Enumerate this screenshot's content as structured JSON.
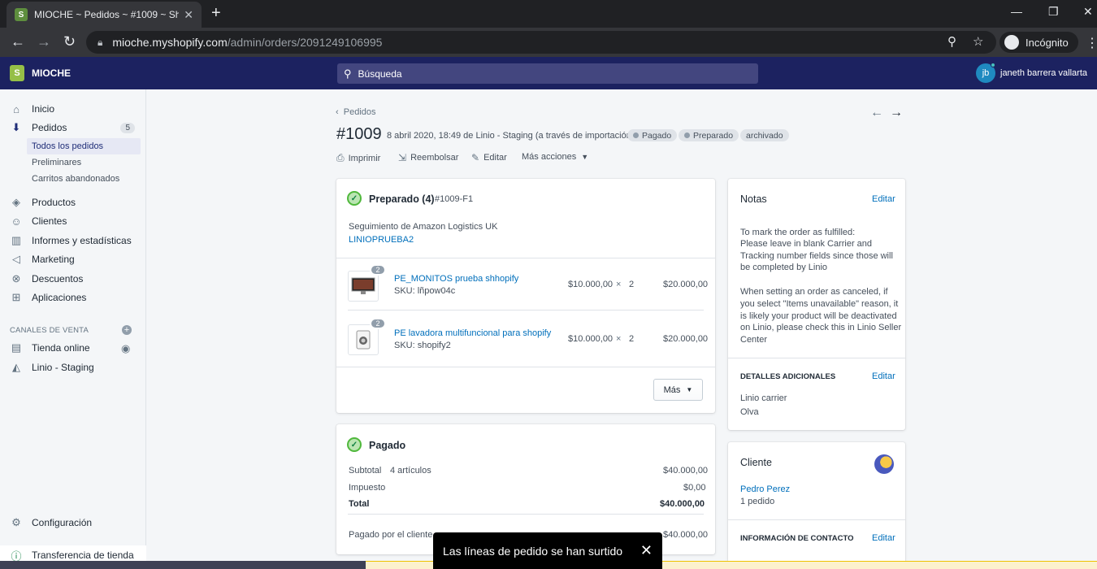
{
  "browser": {
    "tab_title": "MIOCHE ~ Pedidos ~ #1009 ~ Sh",
    "url_host": "mioche.myshopify.com",
    "url_path": "/admin/orders/2091249106995",
    "incognito_label": "Incógnito"
  },
  "topbar": {
    "shop_name": "MIOCHE",
    "search_placeholder": "Búsqueda",
    "avatar_initials": "jb",
    "user_name": "janeth barrera vallarta"
  },
  "sidebar": {
    "items": [
      {
        "label": "Inicio",
        "icon": "home-icon"
      },
      {
        "label": "Pedidos",
        "icon": "orders-icon",
        "badge": "5"
      },
      {
        "label": "Productos",
        "icon": "tag-icon"
      },
      {
        "label": "Clientes",
        "icon": "person-icon"
      },
      {
        "label": "Informes y estadísticas",
        "icon": "chart-icon"
      },
      {
        "label": "Marketing",
        "icon": "megaphone-icon"
      },
      {
        "label": "Descuentos",
        "icon": "discount-icon"
      },
      {
        "label": "Aplicaciones",
        "icon": "apps-icon"
      }
    ],
    "sub_items": [
      "Todos los pedidos",
      "Preliminares",
      "Carritos abandonados"
    ],
    "channels_label": "CANALES DE VENTA",
    "channels": [
      "Tienda online",
      "Linio - Staging"
    ],
    "settings_label": "Configuración",
    "transfer_label": "Transferencia de tienda"
  },
  "order": {
    "breadcrumb": "Pedidos",
    "number": "#1009",
    "meta": "8 abril 2020, 18:49 de Linio - Staging (a través de importación)",
    "badges": [
      "Pagado",
      "Preparado",
      "archivado"
    ],
    "actions": [
      "Imprimir",
      "Reembolsar",
      "Editar",
      "Más acciones"
    ]
  },
  "fulfillment": {
    "title": "Preparado (4)",
    "id": "#1009-F1",
    "tracking_label": "Seguimiento de Amazon Logistics UK",
    "tracking_number": "LINIOPRUEBA2",
    "items": [
      {
        "qty": "2",
        "name": "PE_MONITOS prueba shhopify",
        "sku": "SKU: lñpow04c",
        "price": "$10.000,00",
        "times": "×",
        "count": "2",
        "total": "$20.000,00"
      },
      {
        "qty": "2",
        "name": "PE lavadora multifuncional para shopify",
        "sku": "SKU: shopify2",
        "price": "$10.000,00",
        "times": "×",
        "count": "2",
        "total": "$20.000,00"
      }
    ],
    "more_button": "Más"
  },
  "payment": {
    "title": "Pagado",
    "subtotal_label": "Subtotal",
    "subtotal_items": "4 artículos",
    "subtotal": "$40.000,00",
    "tax_label": "Impuesto",
    "tax": "$0,00",
    "total_label": "Total",
    "total": "$40.000,00",
    "paid_label": "Pagado por el cliente",
    "paid": "$40.000,00"
  },
  "notes": {
    "title": "Notas",
    "edit": "Editar",
    "para1": [
      "To mark the order as fulfilled:",
      "Please leave in blank Carrier and",
      "Tracking number fields since those will",
      "be completed by Linio"
    ],
    "para2": [
      "When setting an order as canceled, if",
      "you select \"Items unavailable\" reason, it",
      "is likely your product will be deactivated",
      "on Linio, please check this in Linio Seller",
      "Center"
    ],
    "extra_title": "DETALLES ADICIONALES",
    "extra_edit": "Editar",
    "extra_lines": [
      "Linio carrier",
      "Olva"
    ]
  },
  "customer": {
    "title": "Cliente",
    "name": "Pedro Perez",
    "orders": "1 pedido",
    "contact_title": "INFORMACIÓN DE CONTACTO",
    "contact_edit": "Editar"
  },
  "toast": {
    "message": "Las líneas de pedido se han surtido"
  },
  "colors": {
    "topbar": "#1c2260",
    "link": "#006fbb",
    "success": "#50b83c",
    "banner": "#fcf1cd"
  }
}
